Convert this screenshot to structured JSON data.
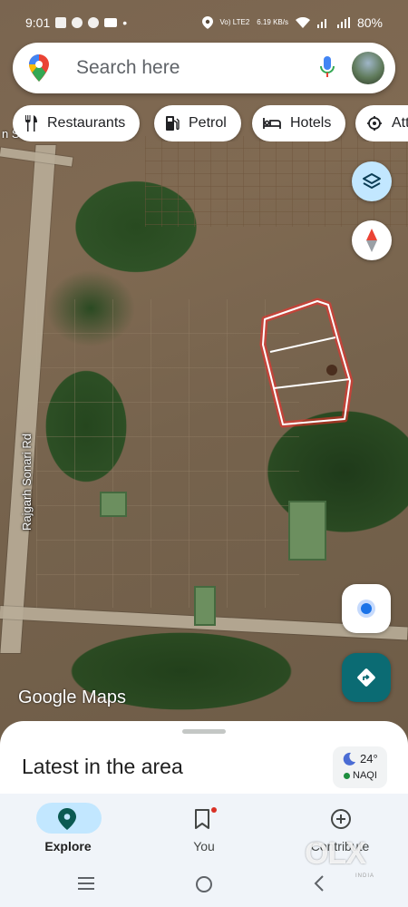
{
  "status_bar": {
    "time": "9:01",
    "network": "Vo) LTE2",
    "speed": "6.19 KB/s",
    "battery": "80%"
  },
  "search": {
    "placeholder": "Search here"
  },
  "chips": [
    {
      "label": "Restaurants",
      "icon": "restaurant-icon"
    },
    {
      "label": "Petrol",
      "icon": "gas-station-icon"
    },
    {
      "label": "Hotels",
      "icon": "hotel-bed-icon"
    },
    {
      "label": "Att",
      "icon": "attractions-icon"
    }
  ],
  "map": {
    "road_label": "Rajgarh Sonari Rd",
    "edge_label": "n S",
    "logo": "Google Maps",
    "plot_color": "#ff2a2a"
  },
  "sheet": {
    "title": "Latest in the area",
    "weather": {
      "temp": "24°",
      "aqi": "NAQI",
      "icon": "moon-icon"
    }
  },
  "bottom_nav": [
    {
      "label": "Explore",
      "icon": "location-pin-icon",
      "active": true
    },
    {
      "label": "You",
      "icon": "bookmark-icon",
      "active": false
    },
    {
      "label": "Contribute",
      "icon": "add-circle-icon",
      "active": false
    }
  ],
  "watermark": {
    "text": "OLX",
    "sub": "INDIA"
  },
  "colors": {
    "accent": "#0b6b73",
    "pill": "#c2e7ff",
    "nav_bg": "#f0f4f9"
  }
}
